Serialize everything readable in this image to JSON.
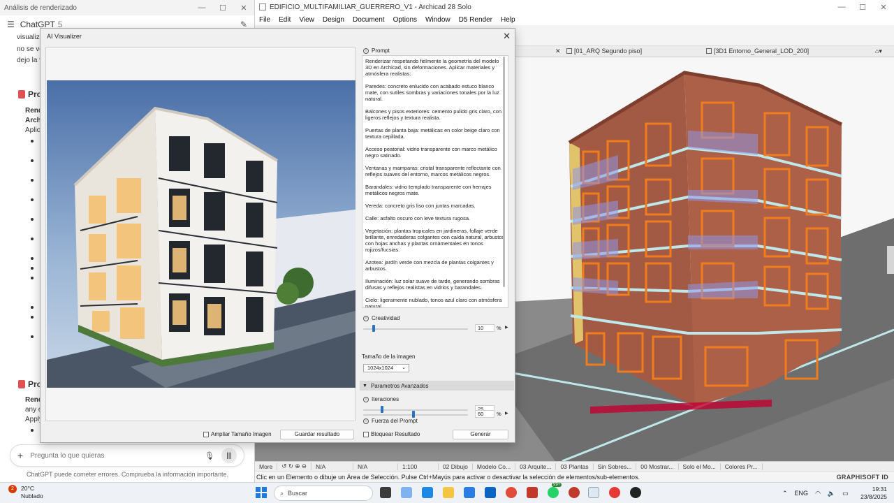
{
  "chat": {
    "window_title": "Análisis de renderizado",
    "header_title": "ChatGPT",
    "header_version": "5",
    "fragments": [
      "visualize",
      "no se vea",
      "dejo la ve"
    ],
    "heading1": "Pro",
    "heading2": "Pro",
    "side_lines1": [
      "Rend",
      "Archi",
      "Aplica"
    ],
    "side_lines2": [
      "Rend",
      "any d",
      "Apply"
    ],
    "input_placeholder": "Pregunta lo que quieras",
    "disclaimer": "ChatGPT puede cometer errores. Comprueba la información importante."
  },
  "archicad": {
    "window_title": "EDIFICIO_MULTIFAMILIAR_GUERRERO_V1 - Archicad 28 Solo",
    "menu": [
      "File",
      "Edit",
      "View",
      "Design",
      "Document",
      "Options",
      "Window",
      "D5 Render",
      "Help"
    ],
    "tabs": [
      "[01_ARQ Segundo piso]",
      "[3D1 Entorno_General_LOD_200]"
    ],
    "nav_items": [
      "More",
      "N/A",
      "N/A",
      "1:100",
      "02 Dibujo",
      "Modelo Co...",
      "03 Arquite...",
      "03 Plantas",
      "Sin Sobres...",
      "00 Mostrar...",
      "Solo el Mo...",
      "Colores Pr..."
    ],
    "status_text": "Clic en un Elemento o dibuje un Área de Selección. Pulse Ctrl+Mayús para activar o desactivar la selección de elementos/sub-elementos.",
    "brand": "GRAPHISOFT ID",
    "colors": {
      "brick": "#a35a45",
      "frame": "#f07c1e",
      "glass": "#8f95e6",
      "ground": "#6e6e6e"
    }
  },
  "dialog": {
    "title": "AI Visualizer",
    "prompt_label": "Prompt",
    "prompt_paragraphs": [
      "Renderizar respetando fielmente la geometría del modelo 3D en Archicad, sin deformaciones. Aplicar materiales y atmósfera realistas:",
      "Paredes: concreto enlucido con acabado estuco blanco mate, con sutiles sombras y variaciones tonales por la luz natural.",
      "Balcones y pisos exteriores: cemento pulido gris claro, con ligeros reflejos y textura realista.",
      "Puertas de planta baja: metálicas en color beige claro con textura cepillada.",
      "Acceso peatonal: vidrio transparente con marco metálico negro satinado.",
      "Ventanas y mamparas: cristal transparente reflectante con reflejos suaves del entorno, marcos metálicos negros.",
      "Barandales: vidrio templado transparente con herrajes metálicos negros mate.",
      "Vereda: concreto gris liso con juntas marcadas.",
      "Calle: asfalto oscuro con leve textura rugosa.",
      "Vegetación: plantas tropicales en jardineras, follaje verde brillante, enredaderas colgantes con caída natural, arbustos con hojas anchas y plantas ornamentales en tonos rojizos/fucsias.",
      "Azotea: jardín verde con mezcla de plantas colgantes y arbustos.",
      "Iluminación: luz solar suave de tarde, generando sombras difusas y reflejos realistas en vidrios y barandales.",
      "Cielo: ligeramente nublado, tonos azul claro con atmósfera natural."
    ],
    "creativity": {
      "label": "Creatividad",
      "value": "10",
      "unit": "%",
      "fraction": 0.1
    },
    "image_size": {
      "label": "Tamaño de la imagen",
      "value": "1024x1024"
    },
    "advanced": {
      "label": "Parametros Avanzados"
    },
    "iterations": {
      "label": "Iteraciones",
      "value": "25",
      "fraction": 0.18
    },
    "prompt_strength": {
      "label": "Fuerza del Prompt",
      "value": "60",
      "unit": "%",
      "fraction": 0.48
    },
    "enlarge_label": "Ampliar Tamaño Imagen",
    "save_label": "Guardar resultado",
    "lock_label": "Bloquear Resultado",
    "generate_label": "Generar"
  },
  "taskbar": {
    "temperature": "20°C",
    "weather": "Nublado",
    "alert_badge": "2",
    "search_placeholder": "Buscar",
    "notif_badge": "99+",
    "language": "ENG",
    "time": "19:31",
    "date": "23/8/2025"
  }
}
